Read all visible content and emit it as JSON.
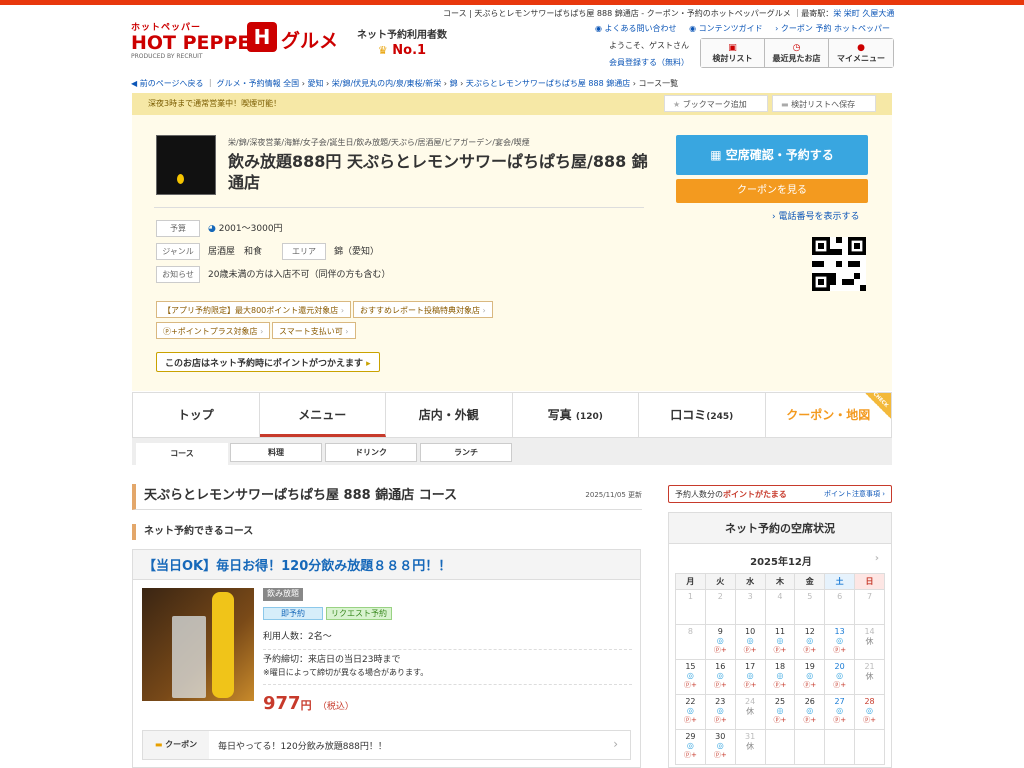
{
  "header": {
    "logo_kana": "ホットペッパー",
    "logo_main": "HOT PEPPER",
    "logo_gurume": "グルメ",
    "logo_produced": "PRODUCED BY RECRUIT",
    "net_yoyaku": "ネット予約利用者数",
    "no1": "No.1",
    "page_title": "コース | 天ぷらとレモンサワーぱちぱち屋 888 錦通店 - クーポン・予約のホットペッパーグルメ",
    "station_label": "最寄駅：",
    "stations": "栄 栄町 久屋大通",
    "links": [
      "よくある問い合わせ",
      "コンテンツガイド",
      "クーポン 予約 ホットペッパー"
    ],
    "welcome": "ようこそ、ゲストさん",
    "register": "会員登録する（無料）",
    "buttons": [
      "検討リスト",
      "最近見たお店",
      "マイメニュー"
    ]
  },
  "breadcrumbs": [
    "前のページへ戻る",
    "グルメ・予約情報 全国",
    "愛知",
    "栄/錦/伏見丸の内/泉/東桜/新栄",
    "錦",
    "天ぷらとレモンサワーぱちぱち屋 888 錦通店",
    "コース一覧"
  ],
  "notice": "深夜3時まで通常営業中！喫煙可能！",
  "bookmark": "ブックマーク追加",
  "save_list": "検討リストへ保存",
  "shop": {
    "genre_line": "栄/錦/深夜営業/海鮮/女子会/誕生日/飲み放題/天ぷら/居酒屋/ビアガーデン/宴会/喫煙",
    "name": "飲み放題888円 天ぷらとレモンサワーぱちぱち屋/888 錦通店",
    "budget_label": "予算",
    "budget": "2001～3000円",
    "genre_label": "ジャンル",
    "genre": "居酒屋　和食",
    "area_label": "エリア",
    "area": "錦（愛知）",
    "notice_label": "お知らせ",
    "notice": "20歳未満の方は入店不可（同伴の方も含む）",
    "tags": [
      "【アプリ予約限定】最大800ポイント還元対象店",
      "おすすめレポート投稿特典対象店",
      "ⓟ+ポイントプラス対象店",
      "スマート支払い可"
    ],
    "point_btn": "このお店はネット予約時にポイントがつかえます",
    "reserve_btn": "空席確認・予約する",
    "coupon_btn": "クーポンを見る",
    "tel": "電話番号を表示する"
  },
  "tabs": [
    {
      "label": "トップ",
      "count": ""
    },
    {
      "label": "メニュー",
      "count": ""
    },
    {
      "label": "店内・外観",
      "count": ""
    },
    {
      "label": "写真",
      "count": "(120)"
    },
    {
      "label": "口コミ",
      "count": "(245)"
    },
    {
      "label": "クーポン・地図",
      "count": ""
    }
  ],
  "check_flag": "CHECK",
  "subtabs": [
    "コース",
    "料理",
    "ドリンク",
    "ランチ"
  ],
  "main": {
    "title": "天ぷらとレモンサワーぱちぱち屋 888 錦通店 コース",
    "updated": "2025/11/05 更新",
    "section": "ネット予約できるコース",
    "course": {
      "title": "【当日OK】毎日お得！120分飲み放題８８８円！！",
      "tag_nomi": "飲み放題",
      "tag_soku": "即予約",
      "tag_req": "リクエスト予約",
      "people": "利用人数：2名～",
      "deadline": "予約締切：来店日の当日23時まで",
      "deadline_note": "※曜日によって締切が異なる場合があります。",
      "price": "977",
      "price_unit": "円",
      "tax": "（税込）",
      "coupon_label": "クーポン",
      "coupon_text": "毎日やってる！120分飲み放題888円！！"
    }
  },
  "right": {
    "point_bar_a": "予約人数分の",
    "point_bar_b": "ポイントがたまる",
    "point_note": "ポイント注意事項",
    "cal_title": "ネット予約の空席状況",
    "month": "2025年12月",
    "weekdays": [
      "月",
      "火",
      "水",
      "木",
      "金",
      "土",
      "日"
    ],
    "weeks": [
      [
        {
          "d": "1",
          "s": "p"
        },
        {
          "d": "2",
          "s": "p"
        },
        {
          "d": "3",
          "s": "p"
        },
        {
          "d": "4",
          "s": "p"
        },
        {
          "d": "5",
          "s": "p"
        },
        {
          "d": "6",
          "s": "p"
        },
        {
          "d": "7",
          "s": "p"
        }
      ],
      [
        {
          "d": "8",
          "s": "p"
        },
        {
          "d": "9",
          "s": "o"
        },
        {
          "d": "10",
          "s": "o"
        },
        {
          "d": "11",
          "s": "o"
        },
        {
          "d": "12",
          "s": "o"
        },
        {
          "d": "13",
          "s": "o"
        },
        {
          "d": "14",
          "s": "r"
        }
      ],
      [
        {
          "d": "15",
          "s": "o"
        },
        {
          "d": "16",
          "s": "o"
        },
        {
          "d": "17",
          "s": "o"
        },
        {
          "d": "18",
          "s": "o"
        },
        {
          "d": "19",
          "s": "o"
        },
        {
          "d": "20",
          "s": "o"
        },
        {
          "d": "21",
          "s": "r"
        }
      ],
      [
        {
          "d": "22",
          "s": "o"
        },
        {
          "d": "23",
          "s": "o"
        },
        {
          "d": "24",
          "s": "r"
        },
        {
          "d": "25",
          "s": "o"
        },
        {
          "d": "26",
          "s": "o"
        },
        {
          "d": "27",
          "s": "o"
        },
        {
          "d": "28",
          "s": "o"
        }
      ],
      [
        {
          "d": "29",
          "s": "o"
        },
        {
          "d": "30",
          "s": "o"
        },
        {
          "d": "31",
          "s": "r"
        },
        {
          "d": "",
          "s": "e"
        },
        {
          "d": "",
          "s": "e"
        },
        {
          "d": "",
          "s": "e"
        },
        {
          "d": "",
          "s": "e"
        }
      ]
    ],
    "mark_ok": "◎",
    "mark_pt": "ⓟ+",
    "mark_rest": "休"
  }
}
